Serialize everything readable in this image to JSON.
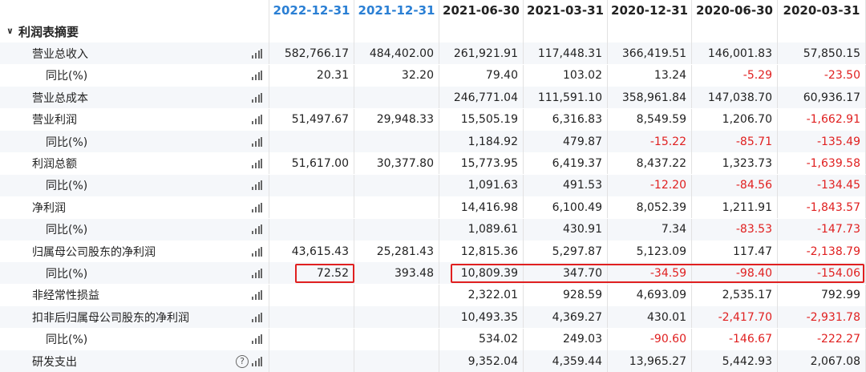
{
  "columns": [
    {
      "label": "2022-12-31",
      "highlight": true
    },
    {
      "label": "2021-12-31",
      "highlight": true
    },
    {
      "label": "2021-06-30",
      "highlight": false
    },
    {
      "label": "2021-03-31",
      "highlight": false
    },
    {
      "label": "2020-12-31",
      "highlight": false
    },
    {
      "label": "2020-06-30",
      "highlight": false
    },
    {
      "label": "2020-03-31",
      "highlight": false
    }
  ],
  "section": {
    "title": "利润表摘要",
    "icon": "chevron-down-icon"
  },
  "rows": [
    {
      "label": "营业总收入",
      "indent": 1,
      "icon": "bar-chart-icon",
      "values": [
        "582,766.17",
        "484,402.00",
        "261,921.91",
        "117,448.31",
        "366,419.51",
        "146,001.83",
        "57,850.15"
      ]
    },
    {
      "label": "同比(%)",
      "indent": 2,
      "icon": "bar-chart-icon",
      "values": [
        "20.31",
        "32.20",
        "79.40",
        "103.02",
        "13.24",
        "-5.29",
        "-23.50"
      ]
    },
    {
      "label": "营业总成本",
      "indent": 1,
      "icon": "bar-chart-icon",
      "values": [
        "",
        "",
        "246,771.04",
        "111,591.10",
        "358,961.84",
        "147,038.70",
        "60,936.17"
      ]
    },
    {
      "label": "营业利润",
      "indent": 1,
      "icon": "bar-chart-icon",
      "values": [
        "51,497.67",
        "29,948.33",
        "15,505.19",
        "6,316.83",
        "8,549.59",
        "1,206.70",
        "-1,662.91"
      ]
    },
    {
      "label": "同比(%)",
      "indent": 2,
      "icon": "bar-chart-icon",
      "values": [
        "",
        "",
        "1,184.92",
        "479.87",
        "-15.22",
        "-85.71",
        "-135.49"
      ]
    },
    {
      "label": "利润总额",
      "indent": 1,
      "icon": "bar-chart-icon",
      "values": [
        "51,617.00",
        "30,377.80",
        "15,773.95",
        "6,419.37",
        "8,437.22",
        "1,323.73",
        "-1,639.58"
      ]
    },
    {
      "label": "同比(%)",
      "indent": 2,
      "icon": "bar-chart-icon",
      "values": [
        "",
        "",
        "1,091.63",
        "491.53",
        "-12.20",
        "-84.56",
        "-134.45"
      ]
    },
    {
      "label": "净利润",
      "indent": 1,
      "icon": "bar-chart-icon",
      "values": [
        "",
        "",
        "14,416.98",
        "6,100.49",
        "8,052.39",
        "1,211.91",
        "-1,843.57"
      ]
    },
    {
      "label": "同比(%)",
      "indent": 2,
      "icon": "bar-chart-icon",
      "values": [
        "",
        "",
        "1,089.61",
        "430.91",
        "7.34",
        "-83.53",
        "-147.73"
      ]
    },
    {
      "label": "归属母公司股东的净利润",
      "indent": 1,
      "icon": "bar-chart-icon",
      "values": [
        "43,615.43",
        "25,281.43",
        "12,815.36",
        "5,297.87",
        "5,123.09",
        "117.47",
        "-2,138.79"
      ]
    },
    {
      "label": "同比(%)",
      "indent": 2,
      "icon": "bar-chart-icon",
      "values": [
        "72.52",
        "393.48",
        "10,809.39",
        "347.70",
        "-34.59",
        "-98.40",
        "-154.06"
      ]
    },
    {
      "label": "非经常性损益",
      "indent": 1,
      "icon": "bar-chart-icon",
      "values": [
        "",
        "",
        "2,322.01",
        "928.59",
        "4,693.09",
        "2,535.17",
        "792.99"
      ]
    },
    {
      "label": "扣非后归属母公司股东的净利润",
      "indent": 1,
      "icon": "bar-chart-icon",
      "values": [
        "",
        "",
        "10,493.35",
        "4,369.27",
        "430.01",
        "-2,417.70",
        "-2,931.78"
      ]
    },
    {
      "label": "同比(%)",
      "indent": 2,
      "icon": "bar-chart-icon",
      "values": [
        "",
        "",
        "534.02",
        "249.03",
        "-90.60",
        "-146.67",
        "-222.27"
      ]
    },
    {
      "label": "研发支出",
      "indent": 1,
      "icon": "bar-chart-icon",
      "help_icon": "help-circle-icon",
      "help_glyph": "?",
      "values": [
        "",
        "",
        "9,352.04",
        "4,359.44",
        "13,965.27",
        "5,442.93",
        "2,067.08"
      ]
    }
  ],
  "colors": {
    "header_highlight": "#2a7fd4",
    "negative": "#e02020",
    "annotation_box": "#e02020",
    "row_alt": "#f5f7fa"
  }
}
